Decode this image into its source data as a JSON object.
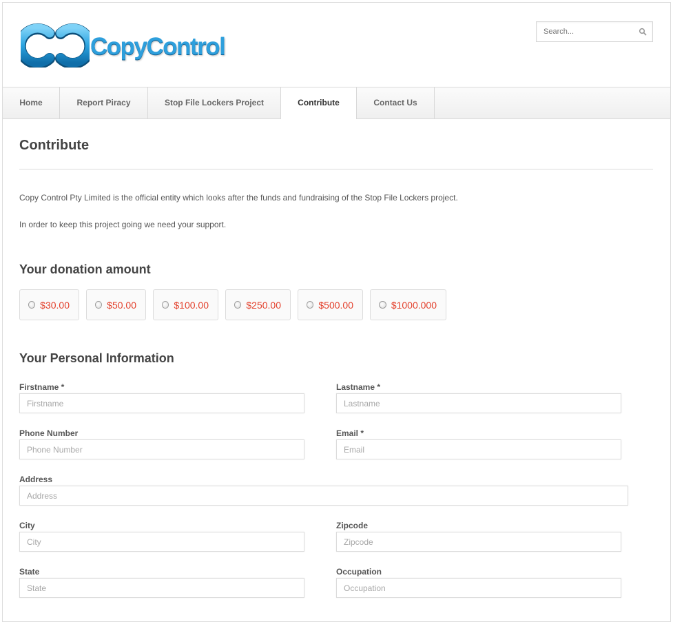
{
  "brand": {
    "name": "CopyControl",
    "accent": "#2e9fdc"
  },
  "search": {
    "placeholder": "Search...",
    "icon": "search-icon"
  },
  "nav": {
    "items": [
      {
        "label": "Home"
      },
      {
        "label": "Report Piracy"
      },
      {
        "label": "Stop File Lockers Project"
      },
      {
        "label": "Contribute",
        "active": true
      },
      {
        "label": "Contact Us"
      }
    ]
  },
  "page": {
    "title": "Contribute",
    "intro1": "Copy Control Pty Limited is the official entity which looks after the funds and fundraising of the Stop File Lockers project.",
    "intro2": "In order to keep this project going we need your support."
  },
  "donation": {
    "title": "Your donation amount",
    "amounts": [
      "$30.00",
      "$50.00",
      "$100.00",
      "$250.00",
      "$500.00",
      "$1000.000"
    ],
    "amount_color": "#e3402c"
  },
  "personal": {
    "title": "Your Personal Information",
    "fields": {
      "firstname": {
        "label": "Firstname *",
        "placeholder": "Firstname"
      },
      "lastname": {
        "label": "Lastname *",
        "placeholder": "Lastname"
      },
      "phone": {
        "label": "Phone Number",
        "placeholder": "Phone Number"
      },
      "email": {
        "label": "Email *",
        "placeholder": "Email"
      },
      "address": {
        "label": "Address",
        "placeholder": "Address"
      },
      "city": {
        "label": "City",
        "placeholder": "City"
      },
      "zipcode": {
        "label": "Zipcode",
        "placeholder": "Zipcode"
      },
      "state": {
        "label": "State",
        "placeholder": "State"
      },
      "occupation": {
        "label": "Occupation",
        "placeholder": "Occupation"
      }
    }
  }
}
